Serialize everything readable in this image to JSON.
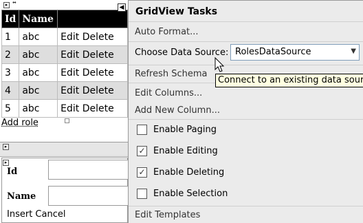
{
  "grid": {
    "headers": [
      "Id",
      "Name",
      ""
    ],
    "rows": [
      [
        "1",
        "abc",
        "Edit Delete"
      ],
      [
        "2",
        "abc",
        "Edit Delete"
      ],
      [
        "3",
        "abc",
        "Edit Delete"
      ],
      [
        "4",
        "abc",
        "Edit Delete"
      ],
      [
        "5",
        "abc",
        "Edit Delete"
      ]
    ],
    "add_role": "Add role"
  },
  "form": {
    "id_label": "Id",
    "name_label": "Name",
    "insert_cancel": "Insert Cancel"
  },
  "tasks": {
    "title": "GridView Tasks",
    "auto_format": "Auto Format...",
    "choose_ds_label": "Choose Data Source:",
    "data_source_value": "RolesDataSource",
    "refresh_schema": "Refresh Schema",
    "edit_columns": "Edit Columns...",
    "add_new_column": "Add New Column...",
    "checkboxes": [
      {
        "label": "Enable Paging",
        "checked": false
      },
      {
        "label": "Enable Editing",
        "checked": true
      },
      {
        "label": "Enable Deleting",
        "checked": true
      },
      {
        "label": "Enable Selection",
        "checked": false
      }
    ],
    "edit_templates": "Edit Templates",
    "tooltip": "Connect to an existing data source"
  },
  "icons": {
    "smart_tag": "smart-tag-arrow-icon",
    "cursor": "mouse-cursor-icon",
    "dropdown": "chevron-down-icon",
    "move": "move-glyph-icon"
  }
}
